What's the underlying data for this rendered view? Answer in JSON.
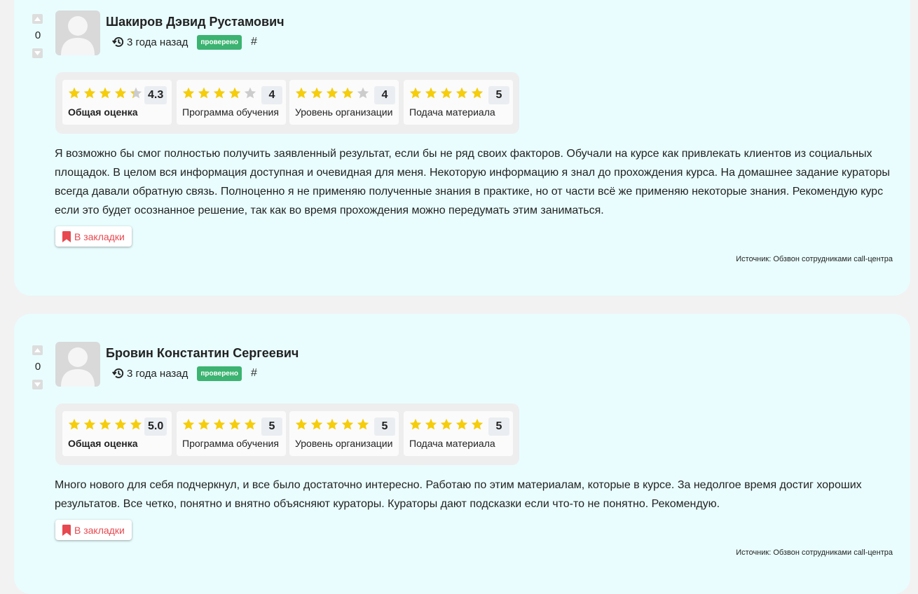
{
  "colors": {
    "card_bg": "#e9fdfe",
    "page_bg": "#f2f2f2",
    "star_filled": "#f5cd0a",
    "star_empty": "#cccccc",
    "badge_bg": "#3cb371",
    "bookmark_text": "#e8484f"
  },
  "reviews": [
    {
      "votes": "0",
      "author": "Шакиров Дэвид Рустамович",
      "time_ago": "3 года назад",
      "verified_badge": "проверено",
      "permalink": "#",
      "ratings": [
        {
          "stars": 4.3,
          "score": "4.3",
          "label": "Общая оценка"
        },
        {
          "stars": 4,
          "score": "4",
          "label": "Программа обучения"
        },
        {
          "stars": 4,
          "score": "4",
          "label": "Уровень организации"
        },
        {
          "stars": 5,
          "score": "5",
          "label": "Подача материала"
        }
      ],
      "text": "Я возможно бы смог полностью получить заявленный результат, если бы не ряд своих факторов. Обучали на курсе как привлекать клиентов из социальных площадок. В целом вся информация доступная и очевидная для меня. Некоторую информацию я знал до прохождения курса. На домашнее задание кураторы всегда давали обратную связь. Полноценно я не применяю полученные знания в практике, но от части всё же применяю некоторые знания. Рекомендую курс если это будет осознанное решение, так как во время прохождения можно передумать этим заниматься.",
      "bookmark_label": "В закладки",
      "source": "Источник: Обзвон сотрудниками call-центра"
    },
    {
      "votes": "0",
      "author": "Бровин Константин Сергеевич",
      "time_ago": "3 года назад",
      "verified_badge": "проверено",
      "permalink": "#",
      "ratings": [
        {
          "stars": 5,
          "score": "5.0",
          "label": "Общая оценка"
        },
        {
          "stars": 5,
          "score": "5",
          "label": "Программа обучения"
        },
        {
          "stars": 5,
          "score": "5",
          "label": "Уровень организации"
        },
        {
          "stars": 5,
          "score": "5",
          "label": "Подача материала"
        }
      ],
      "text": "Много нового для себя подчеркнул, и все было достаточно интересно. Работаю по этим материалам, которые в курсе. За недолгое время достиг хороших результатов. Все четко, понятно и внятно объясняют кураторы. Кураторы дают подсказки если что-то не понятно. Рекомендую.",
      "bookmark_label": "В закладки",
      "source": "Источник: Обзвон сотрудниками call-центра"
    }
  ]
}
